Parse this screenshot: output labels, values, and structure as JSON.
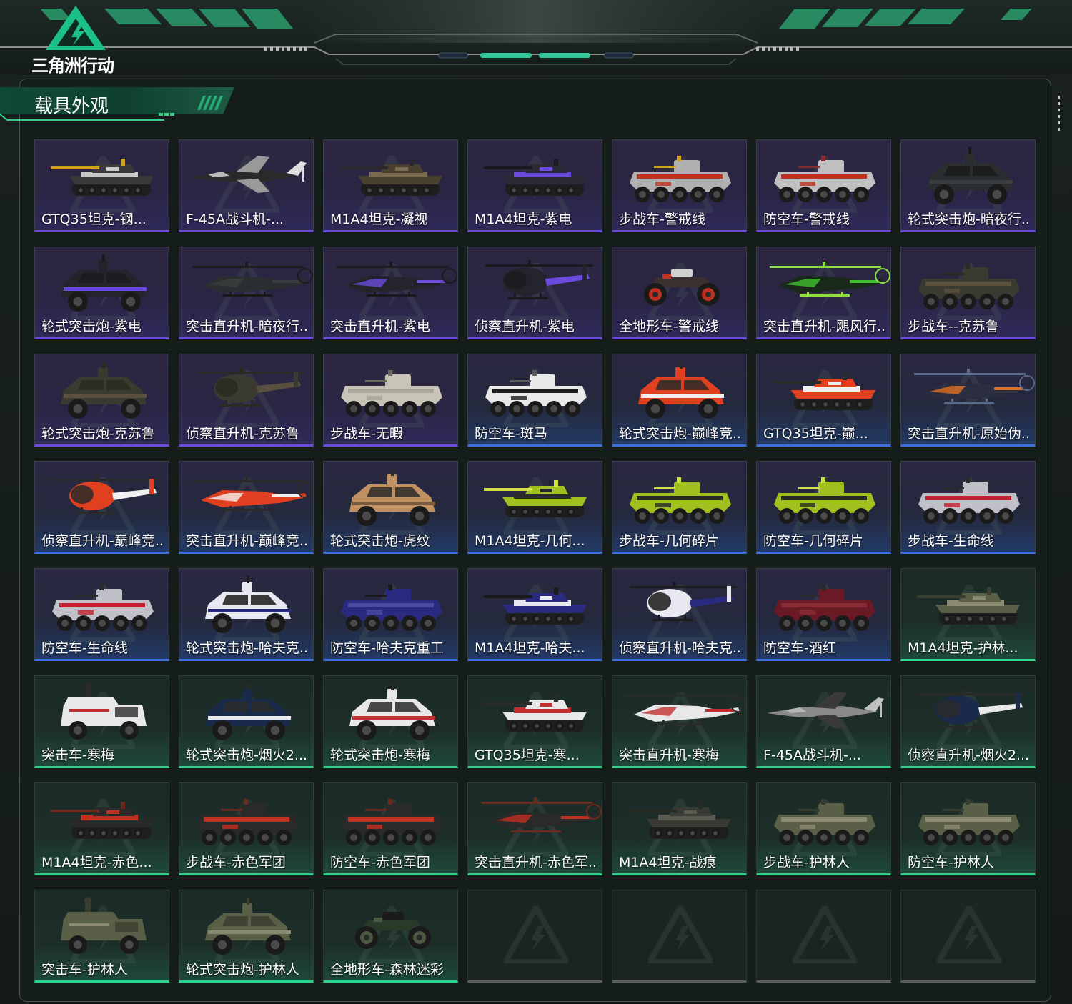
{
  "app": {
    "logo_text": "三角洲行动"
  },
  "section": {
    "title": "载具外观"
  },
  "colors": {
    "purple_accent": "#6a4bdc",
    "blue_accent": "#3a6fdc",
    "green_accent": "#2ed08a",
    "empty_accent": "#5a605e"
  },
  "items": [
    {
      "label": "GTQ35坦克-钢...",
      "rarity": "purple",
      "kind": "tank",
      "colors": [
        "#3a3a3a",
        "#c8c8c8",
        "#d0a020"
      ]
    },
    {
      "label": "F-45A战斗机-...",
      "rarity": "purple",
      "kind": "jet",
      "colors": [
        "#2a2a2a",
        "#9a9a9a",
        "#e0e0e0"
      ]
    },
    {
      "label": "M1A4坦克-凝视",
      "rarity": "purple",
      "kind": "tank",
      "colors": [
        "#4a4030",
        "#7a6a50",
        "#2a2a2a"
      ]
    },
    {
      "label": "M1A4坦克-紫电",
      "rarity": "purple",
      "kind": "tank",
      "colors": [
        "#2a2a34",
        "#6a4bdc",
        "#1a1a1e"
      ]
    },
    {
      "label": "步战车-警戒线",
      "rarity": "purple",
      "kind": "apc",
      "colors": [
        "#b0b0b0",
        "#c03020",
        "#d0a020"
      ]
    },
    {
      "label": "防空车-警戒线",
      "rarity": "purple",
      "kind": "apc",
      "colors": [
        "#c0c0c0",
        "#c03020",
        "#8a2a2a"
      ]
    },
    {
      "label": "轮式突击炮-暗夜行...",
      "rarity": "purple",
      "kind": "armored",
      "colors": [
        "#2a2e30",
        "#3a3e40",
        "#1a1a1a"
      ]
    },
    {
      "label": "轮式突击炮-紫电",
      "rarity": "purple",
      "kind": "armored",
      "colors": [
        "#24242c",
        "#6a4bdc",
        "#1a1a1e"
      ]
    },
    {
      "label": "突击直升机-暗夜行...",
      "rarity": "purple",
      "kind": "heli",
      "colors": [
        "#2a2e30",
        "#3a3e40",
        "#1a1a1a"
      ]
    },
    {
      "label": "突击直升机-紫电",
      "rarity": "purple",
      "kind": "heli",
      "colors": [
        "#24242c",
        "#6a4bdc",
        "#1a1a1e"
      ]
    },
    {
      "label": "侦察直升机-紫电",
      "rarity": "purple",
      "kind": "scout",
      "colors": [
        "#24242c",
        "#6a4bdc",
        "#1a1a1e"
      ]
    },
    {
      "label": "全地形车-警戒线",
      "rarity": "purple",
      "kind": "atv",
      "colors": [
        "#3a3030",
        "#c03020",
        "#d0d0d0"
      ]
    },
    {
      "label": "突击直升机-飓风行...",
      "rarity": "purple",
      "kind": "heli",
      "colors": [
        "#1a2a1a",
        "#40c030",
        "#8ae040"
      ]
    },
    {
      "label": "步战车--克苏鲁",
      "rarity": "purple",
      "kind": "apc",
      "colors": [
        "#3a3a30",
        "#5a5040",
        "#2a2a20"
      ]
    },
    {
      "label": "轮式突击炮-克苏鲁",
      "rarity": "purple",
      "kind": "armored",
      "colors": [
        "#3a3a30",
        "#5a5040",
        "#2a2a20"
      ]
    },
    {
      "label": "侦察直升机-克苏鲁",
      "rarity": "purple",
      "kind": "scout",
      "colors": [
        "#3a3a30",
        "#5a5040",
        "#2a2a20"
      ]
    },
    {
      "label": "步战车-无暇",
      "rarity": "purple",
      "kind": "apc",
      "colors": [
        "#c8c4b8",
        "#a8a498",
        "#6a6a60"
      ]
    },
    {
      "label": "防空车-斑马",
      "rarity": "blue",
      "kind": "apc",
      "colors": [
        "#e8e8e8",
        "#1a1a1a",
        "#5a5a5a"
      ]
    },
    {
      "label": "轮式突击炮-巅峰竞...",
      "rarity": "blue",
      "kind": "armored",
      "colors": [
        "#e04020",
        "#f0f0f0",
        "#2a2a2a"
      ]
    },
    {
      "label": "GTQ35坦克-巅...",
      "rarity": "blue",
      "kind": "tank",
      "colors": [
        "#e04020",
        "#f0f0f0",
        "#2a2a2a"
      ]
    },
    {
      "label": "突击直升机-原始伪...",
      "rarity": "blue",
      "kind": "heli",
      "colors": [
        "#2a2e40",
        "#e07020",
        "#5a6a8a"
      ]
    },
    {
      "label": "侦察直升机-巅峰竞...",
      "rarity": "blue",
      "kind": "scout",
      "colors": [
        "#e04020",
        "#f0f0f0",
        "#2a2a2a"
      ]
    },
    {
      "label": "突击直升机-巅峰竞...",
      "rarity": "blue",
      "kind": "heli",
      "colors": [
        "#e04020",
        "#f0f0f0",
        "#2a2a2a"
      ]
    },
    {
      "label": "轮式突击炮-虎纹",
      "rarity": "blue",
      "kind": "armored",
      "colors": [
        "#c09060",
        "#7a5a3a",
        "#2a2a2a"
      ]
    },
    {
      "label": "M1A4坦克-几何...",
      "rarity": "blue",
      "kind": "tank",
      "colors": [
        "#a0c020",
        "#2a2a2a",
        "#d0e040"
      ]
    },
    {
      "label": "步战车-几何碎片",
      "rarity": "blue",
      "kind": "apc",
      "colors": [
        "#a0c020",
        "#2a2a2a",
        "#d0e040"
      ]
    },
    {
      "label": "防空车-几何碎片",
      "rarity": "blue",
      "kind": "apc",
      "colors": [
        "#a0c020",
        "#2a2a2a",
        "#d0e040"
      ]
    },
    {
      "label": "步战车-生命线",
      "rarity": "blue",
      "kind": "apc",
      "colors": [
        "#c0c0c8",
        "#c02030",
        "#2a2a2a"
      ]
    },
    {
      "label": "防空车-生命线",
      "rarity": "blue",
      "kind": "apc",
      "colors": [
        "#c0c0c8",
        "#c02030",
        "#2a2a2a"
      ]
    },
    {
      "label": "轮式突击炮-哈夫克...",
      "rarity": "blue",
      "kind": "armored",
      "colors": [
        "#e8e8f0",
        "#2a2a80",
        "#1a1a1a"
      ]
    },
    {
      "label": "防空车-哈夫克重工",
      "rarity": "blue",
      "kind": "apc",
      "colors": [
        "#2a2a80",
        "#4a4aa0",
        "#1a1a1a"
      ]
    },
    {
      "label": "M1A4坦克-哈夫...",
      "rarity": "blue",
      "kind": "tank",
      "colors": [
        "#2a2a80",
        "#e8e8f0",
        "#1a1a1a"
      ]
    },
    {
      "label": "侦察直升机-哈夫克...",
      "rarity": "blue",
      "kind": "scout",
      "colors": [
        "#e8e8f0",
        "#2a2a80",
        "#1a1a1a"
      ]
    },
    {
      "label": "防空车-酒红",
      "rarity": "blue",
      "kind": "apc",
      "colors": [
        "#6a1a24",
        "#8a2a34",
        "#2a2a2a"
      ]
    },
    {
      "label": "M1A4坦克-护林...",
      "rarity": "green",
      "kind": "tank",
      "colors": [
        "#5a6048",
        "#8a8a70",
        "#3a3e30"
      ]
    },
    {
      "label": "突击车-寒梅",
      "rarity": "green",
      "kind": "truck",
      "colors": [
        "#e8e8e8",
        "#c03030",
        "#2a2a2a"
      ]
    },
    {
      "label": "轮式突击炮-烟火2...",
      "rarity": "green",
      "kind": "armored",
      "colors": [
        "#1a2a4a",
        "#e8e8e8",
        "#2a2a2a"
      ]
    },
    {
      "label": "轮式突击炮-寒梅",
      "rarity": "green",
      "kind": "armored",
      "colors": [
        "#e8e8e8",
        "#c03030",
        "#2a2a2a"
      ]
    },
    {
      "label": "GTQ35坦克-寒...",
      "rarity": "green",
      "kind": "tank",
      "colors": [
        "#e8e8e8",
        "#c03030",
        "#2a2a2a"
      ]
    },
    {
      "label": "突击直升机-寒梅",
      "rarity": "green",
      "kind": "heli",
      "colors": [
        "#e8e8e8",
        "#c03030",
        "#2a2a2a"
      ]
    },
    {
      "label": "F-45A战斗机-...",
      "rarity": "green",
      "kind": "jet",
      "colors": [
        "#8a8a8a",
        "#3a3a3a",
        "#c0c0c0"
      ]
    },
    {
      "label": "侦察直升机-烟火2...",
      "rarity": "green",
      "kind": "scout",
      "colors": [
        "#1a2a4a",
        "#e8e8e8",
        "#2a2a2a"
      ]
    },
    {
      "label": "M1A4坦克-赤色...",
      "rarity": "green",
      "kind": "tank",
      "colors": [
        "#2a2a2a",
        "#c03020",
        "#6a2a20"
      ]
    },
    {
      "label": "步战车-赤色军团",
      "rarity": "green",
      "kind": "apc",
      "colors": [
        "#2a2a2a",
        "#c03020",
        "#6a2a20"
      ]
    },
    {
      "label": "防空车-赤色军团",
      "rarity": "green",
      "kind": "apc",
      "colors": [
        "#2a2a2a",
        "#c03020",
        "#6a2a20"
      ]
    },
    {
      "label": "突击直升机-赤色军...",
      "rarity": "green",
      "kind": "heli",
      "colors": [
        "#2a2a2a",
        "#c03020",
        "#6a2a20"
      ]
    },
    {
      "label": "M1A4坦克-战痕",
      "rarity": "green",
      "kind": "tank",
      "colors": [
        "#3a3a34",
        "#5a5a50",
        "#2a2a24"
      ]
    },
    {
      "label": "步战车-护林人",
      "rarity": "green",
      "kind": "apc",
      "colors": [
        "#5a6048",
        "#8a8a70",
        "#3a3e30"
      ]
    },
    {
      "label": "防空车-护林人",
      "rarity": "green",
      "kind": "apc",
      "colors": [
        "#5a6048",
        "#8a8a70",
        "#3a3e30"
      ]
    },
    {
      "label": "突击车-护林人",
      "rarity": "green",
      "kind": "truck",
      "colors": [
        "#5a6048",
        "#8a8a70",
        "#3a3e30"
      ]
    },
    {
      "label": "轮式突击炮-护林人",
      "rarity": "green",
      "kind": "armored",
      "colors": [
        "#5a6048",
        "#8a8a70",
        "#3a3e30"
      ]
    },
    {
      "label": "全地形车-森林迷彩",
      "rarity": "green",
      "kind": "atv",
      "colors": [
        "#2a3a2a",
        "#4a5a40",
        "#1a1a1a"
      ]
    },
    {
      "label": "",
      "rarity": "empty",
      "kind": "none",
      "colors": []
    },
    {
      "label": "",
      "rarity": "empty",
      "kind": "none",
      "colors": []
    },
    {
      "label": "",
      "rarity": "empty",
      "kind": "none",
      "colors": []
    },
    {
      "label": "",
      "rarity": "empty",
      "kind": "none",
      "colors": []
    }
  ]
}
